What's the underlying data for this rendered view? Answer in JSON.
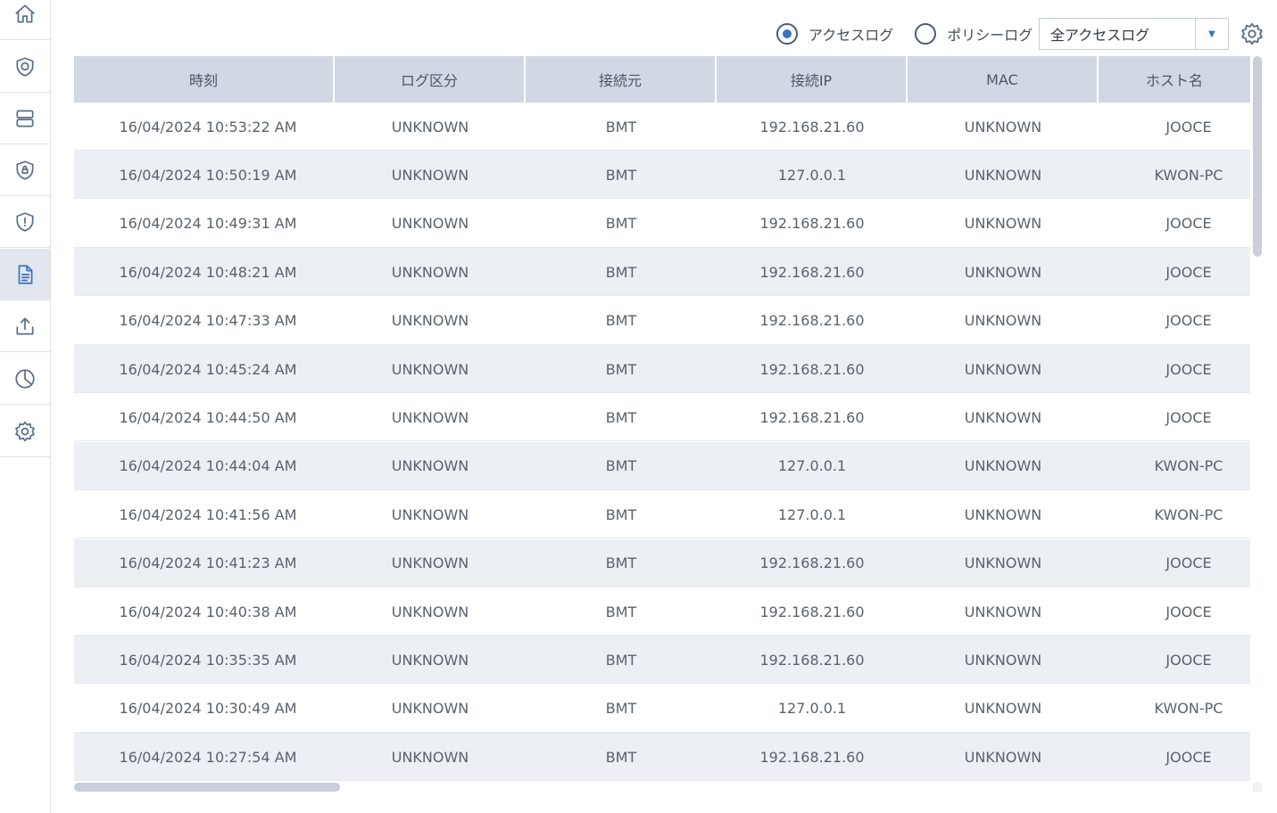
{
  "sidebar": {
    "items": [
      {
        "icon": "home-icon",
        "active": false
      },
      {
        "icon": "shield-badge-icon",
        "active": false
      },
      {
        "icon": "server-icon",
        "active": false
      },
      {
        "icon": "shield-lock-icon",
        "active": false
      },
      {
        "icon": "shield-alert-icon",
        "active": false
      },
      {
        "icon": "document-icon",
        "active": true
      },
      {
        "icon": "upload-icon",
        "active": false
      },
      {
        "icon": "pie-chart-icon",
        "active": false
      },
      {
        "icon": "gear-icon",
        "active": false
      }
    ]
  },
  "toolbar": {
    "radio_access_label": "アクセスログ",
    "radio_policy_label": "ポリシーログ",
    "selected_radio": "access",
    "filter_select_value": "全アクセスログ"
  },
  "table": {
    "columns": [
      "時刻",
      "ログ区分",
      "接続元",
      "接続IP",
      "MAC",
      "ホスト名"
    ],
    "rows": [
      [
        "16/04/2024 10:53:22 AM",
        "UNKNOWN",
        "BMT",
        "192.168.21.60",
        "UNKNOWN",
        "JOOCE"
      ],
      [
        "16/04/2024 10:50:19 AM",
        "UNKNOWN",
        "BMT",
        "127.0.0.1",
        "UNKNOWN",
        "KWON-PC"
      ],
      [
        "16/04/2024 10:49:31 AM",
        "UNKNOWN",
        "BMT",
        "192.168.21.60",
        "UNKNOWN",
        "JOOCE"
      ],
      [
        "16/04/2024 10:48:21 AM",
        "UNKNOWN",
        "BMT",
        "192.168.21.60",
        "UNKNOWN",
        "JOOCE"
      ],
      [
        "16/04/2024 10:47:33 AM",
        "UNKNOWN",
        "BMT",
        "192.168.21.60",
        "UNKNOWN",
        "JOOCE"
      ],
      [
        "16/04/2024 10:45:24 AM",
        "UNKNOWN",
        "BMT",
        "192.168.21.60",
        "UNKNOWN",
        "JOOCE"
      ],
      [
        "16/04/2024 10:44:50 AM",
        "UNKNOWN",
        "BMT",
        "192.168.21.60",
        "UNKNOWN",
        "JOOCE"
      ],
      [
        "16/04/2024 10:44:04 AM",
        "UNKNOWN",
        "BMT",
        "127.0.0.1",
        "UNKNOWN",
        "KWON-PC"
      ],
      [
        "16/04/2024 10:41:56 AM",
        "UNKNOWN",
        "BMT",
        "127.0.0.1",
        "UNKNOWN",
        "KWON-PC"
      ],
      [
        "16/04/2024 10:41:23 AM",
        "UNKNOWN",
        "BMT",
        "192.168.21.60",
        "UNKNOWN",
        "JOOCE"
      ],
      [
        "16/04/2024 10:40:38 AM",
        "UNKNOWN",
        "BMT",
        "192.168.21.60",
        "UNKNOWN",
        "JOOCE"
      ],
      [
        "16/04/2024 10:35:35 AM",
        "UNKNOWN",
        "BMT",
        "192.168.21.60",
        "UNKNOWN",
        "JOOCE"
      ],
      [
        "16/04/2024 10:30:49 AM",
        "UNKNOWN",
        "BMT",
        "127.0.0.1",
        "UNKNOWN",
        "KWON-PC"
      ],
      [
        "16/04/2024 10:27:54 AM",
        "UNKNOWN",
        "BMT",
        "192.168.21.60",
        "UNKNOWN",
        "JOOCE"
      ]
    ]
  },
  "colors": {
    "accent": "#3b72c4",
    "header_bg": "#d2d8e3",
    "row_alt_bg": "#eceff4",
    "sidebar_active_bg": "#e2e6ee"
  }
}
